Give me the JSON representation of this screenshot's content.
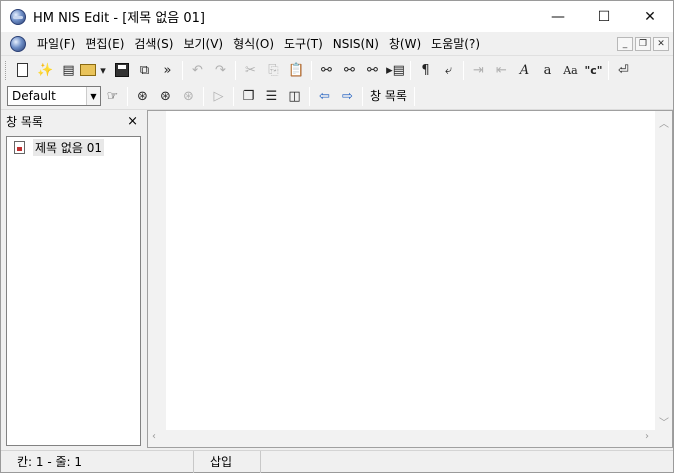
{
  "window": {
    "title": "HM NIS Edit - [제목 없음 01]"
  },
  "titlebar": {
    "minimize": "—",
    "maximize": "☐",
    "close": "✕"
  },
  "menu": {
    "items": [
      "파일(F)",
      "편집(E)",
      "검색(S)",
      "보기(V)",
      "형식(O)",
      "도구(T)",
      "NSIS(N)",
      "창(W)",
      "도움말(?)"
    ],
    "mdi": {
      "minimize": "_",
      "restore": "❐",
      "close": "✕"
    }
  },
  "toolbar2": {
    "config_select": "Default",
    "window_list_label": "창 목록"
  },
  "panel": {
    "title": "창 목록",
    "close": "×",
    "items": [
      "제목 없음 01"
    ]
  },
  "status": {
    "position": "칸: 1 - 줄: 1",
    "mode": "삽입"
  }
}
